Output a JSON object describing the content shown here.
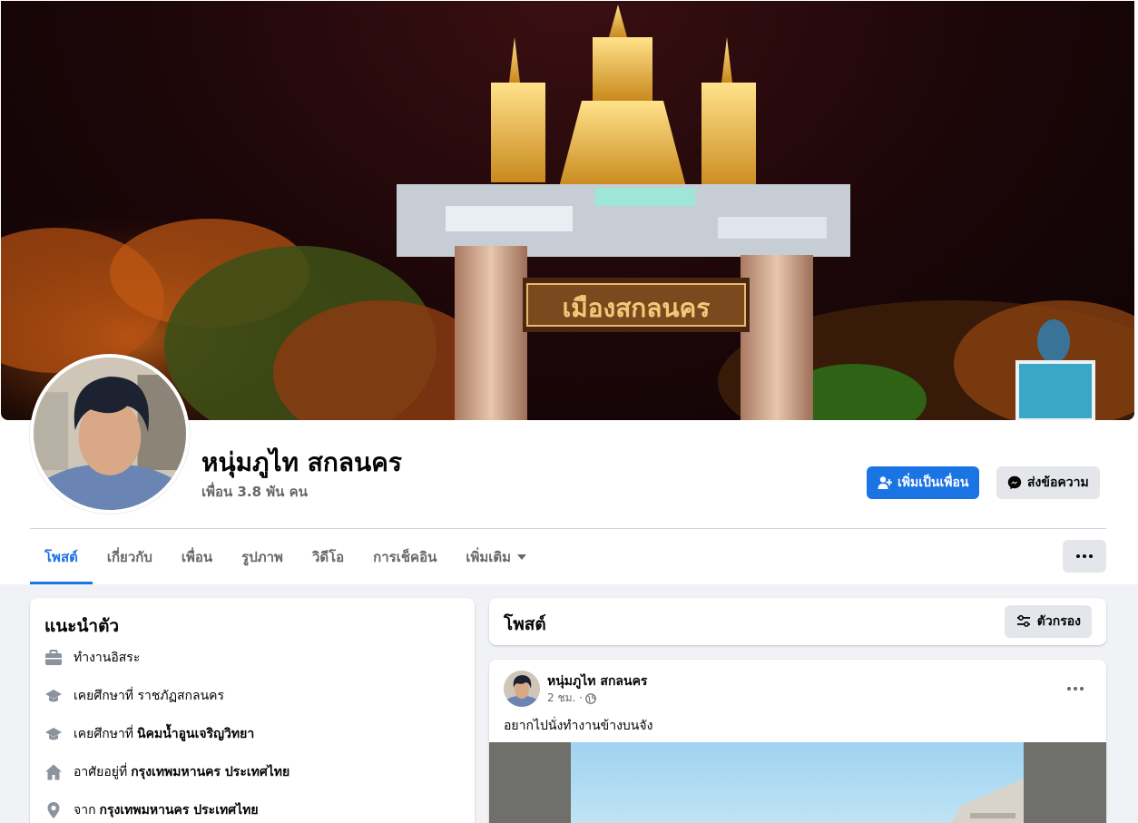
{
  "profile": {
    "name": "หนุ่มภูไท สกลนคร",
    "friend_count": "เพื่อน 3.8 พัน คน",
    "cover_sign_text": "เมืองสกลนคร"
  },
  "actions": {
    "add_friend": "เพิ่มเป็นเพื่อน",
    "message": "ส่งข้อความ"
  },
  "tabs": [
    {
      "label": "โพสต์",
      "active": true
    },
    {
      "label": "เกี่ยวกับ"
    },
    {
      "label": "เพื่อน"
    },
    {
      "label": "รูปภาพ"
    },
    {
      "label": "วิดีโอ"
    },
    {
      "label": "การเช็คอิน"
    },
    {
      "label": "เพิ่มเติม"
    }
  ],
  "intro": {
    "title": "แนะนำตัว",
    "items": [
      {
        "icon": "briefcase-icon",
        "text": "ทำงานอิสระ",
        "bold": ""
      },
      {
        "icon": "graduation-cap-icon",
        "text": "เคยศึกษาที่ ราชภัฏสกลนคร",
        "bold": ""
      },
      {
        "icon": "graduation-cap-icon",
        "text": "เคยศึกษาที่",
        "bold": "นิคมน้ำอูนเจริญวิทยา"
      },
      {
        "icon": "home-icon",
        "text": "อาศัยอยู่ที่",
        "bold": "กรุงเทพมหานคร ประเทศไทย"
      },
      {
        "icon": "location-pin-icon",
        "text": "จาก",
        "bold": "กรุงเทพมหานคร ประเทศไทย"
      }
    ]
  },
  "posts": {
    "title": "โพสต์",
    "filter_label": "ตัวกรอง",
    "items": [
      {
        "author": "หนุ่มภูไท สกลนคร",
        "time": "2 ชม. ·",
        "text": "อยากไปนั่งทำงานข้างบนจัง"
      }
    ]
  },
  "colors": {
    "accent": "#1b74e4",
    "page_background": "#f0f2f5",
    "secondary_button": "#e4e6eb",
    "muted_text": "#65676b"
  }
}
